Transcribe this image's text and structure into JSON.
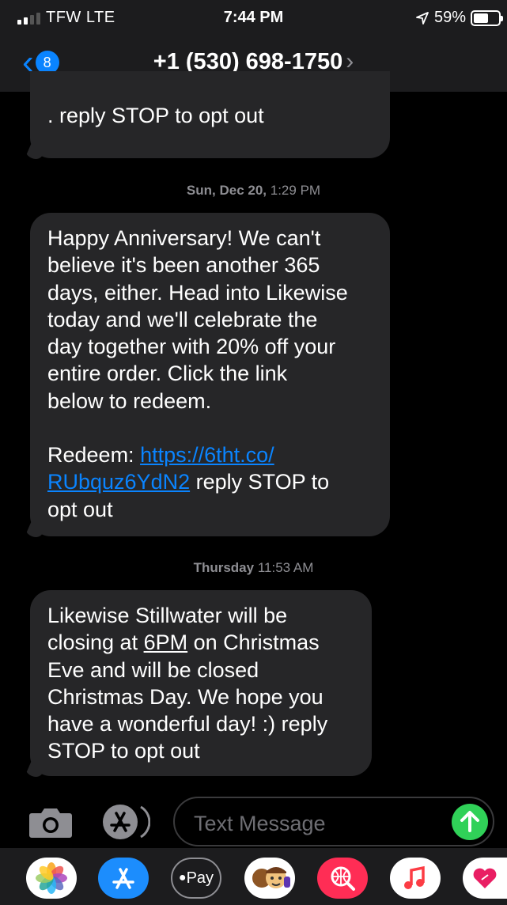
{
  "status_bar": {
    "carrier": "TFW  LTE",
    "time": "7:44 PM",
    "battery": "59%",
    "battery_level": 0.59,
    "signal_bars": 2
  },
  "nav": {
    "back_count": "8",
    "contact": "+1 (530) 698-1750"
  },
  "messages": [
    {
      "text_lines": [
        ". reply STOP to opt out"
      ]
    },
    {
      "timestamp_day": "Sun, Dec 20,",
      "timestamp_time": " 1:29 PM"
    },
    {
      "text_lines": [
        "Happy Anniversary! We can't",
        "believe it's been another 365",
        "days, either. Head into Likewise",
        "today and we'll celebrate the",
        "day together with 20% off your",
        "entire order. Click the link",
        "below to redeem."
      ],
      "redeem_prefix": "Redeem: ",
      "link_part1": "https://6tht.co/",
      "link_part2": "RUbquz6YdN2",
      "after_link": " reply STOP to",
      "last_line": "opt out"
    },
    {
      "timestamp_day": "Thursday",
      "timestamp_time": " 11:53 AM"
    },
    {
      "line1": "Likewise Stillwater will be",
      "line2_prefix": "closing at ",
      "line2_time": "6PM",
      "line2_suffix": " on Christmas",
      "text_lines": [
        "Eve and will be closed",
        "Christmas Day. We hope you",
        "have a wonderful day! :) reply",
        "STOP to opt out"
      ]
    }
  ],
  "composer": {
    "placeholder": "Text Message"
  },
  "app_drawer": [
    {
      "name": "Photos",
      "icon": "photos-icon",
      "color": "#ffffff"
    },
    {
      "name": "App Store",
      "icon": "app-store-icon",
      "color": "#1c8dfd"
    },
    {
      "name": "Apple Pay",
      "icon": "apple-pay-icon",
      "label": "Pay",
      "color": "#2c2c2e"
    },
    {
      "name": "Memoji",
      "icon": "memoji-icon",
      "color": "#ffffff"
    },
    {
      "name": "Search Images",
      "icon": "globe-search-icon",
      "color": "#ff2d55"
    },
    {
      "name": "Music",
      "icon": "music-icon",
      "color": "#ffffff"
    },
    {
      "name": "Digital Touch",
      "icon": "heart-icon",
      "color": "#ffffff"
    }
  ]
}
